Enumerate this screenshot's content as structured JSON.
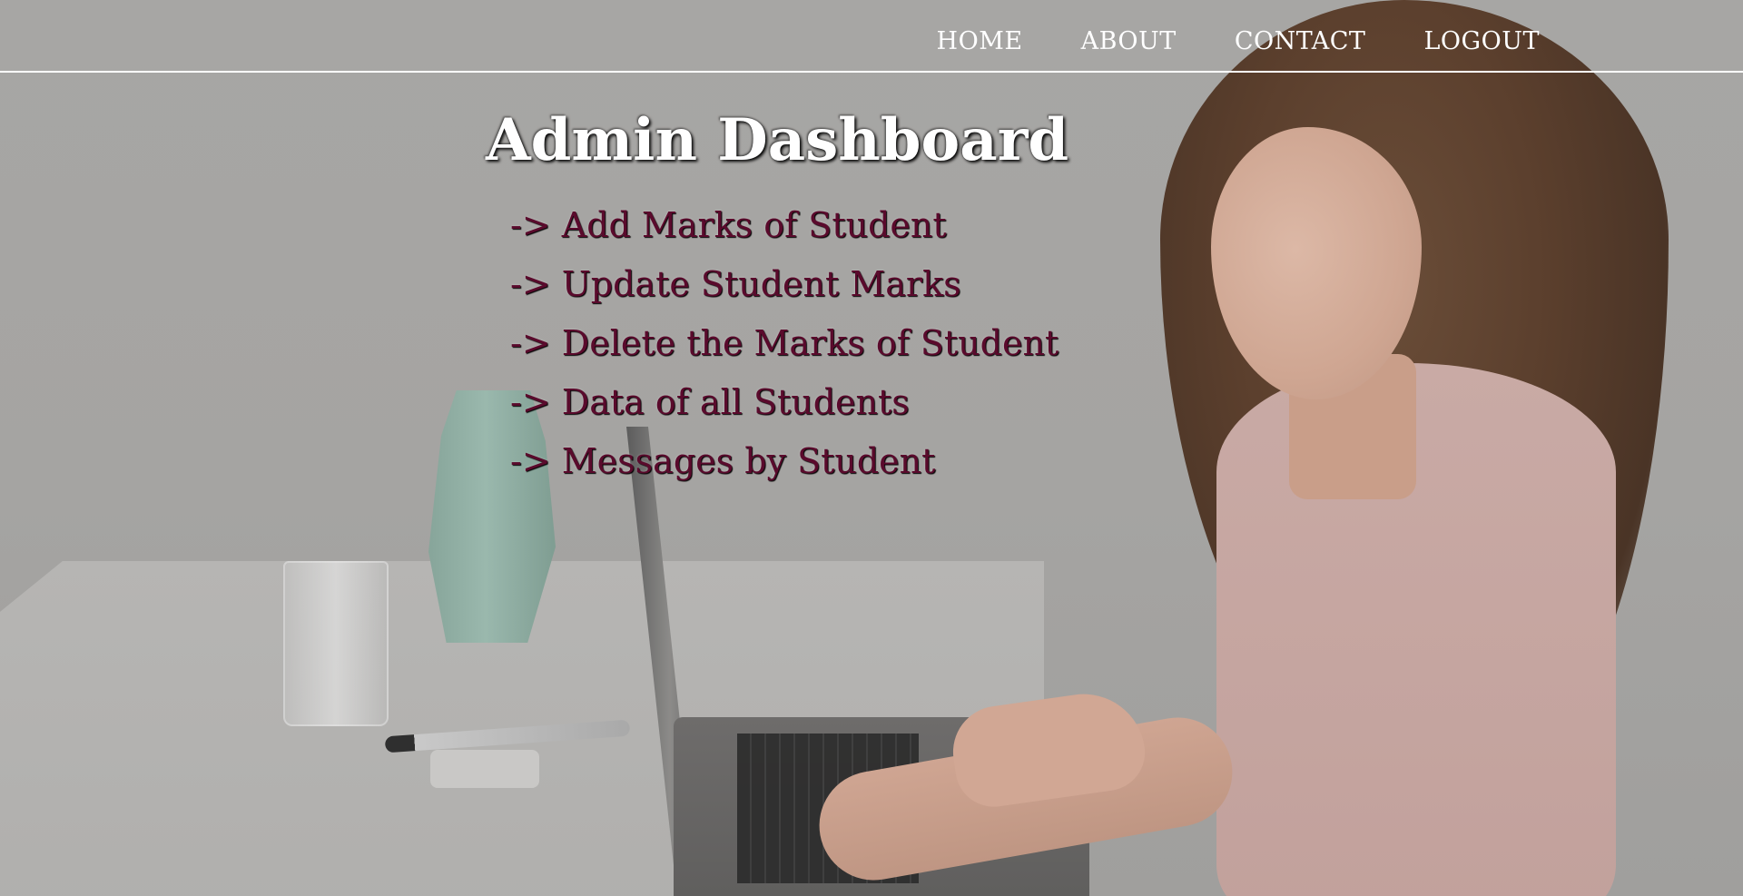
{
  "nav": {
    "items": [
      {
        "label": "HOME"
      },
      {
        "label": "ABOUT"
      },
      {
        "label": "CONTACT"
      },
      {
        "label": "LOGOUT"
      }
    ]
  },
  "page": {
    "title": "Admin Dashboard"
  },
  "menu": {
    "items": [
      {
        "label": "-> Add Marks of Student"
      },
      {
        "label": "-> Update Student Marks"
      },
      {
        "label": "-> Delete the Marks of Student"
      },
      {
        "label": "-> Data of all Students"
      },
      {
        "label": "-> Messages by Student"
      }
    ]
  },
  "colors": {
    "nav_text": "#ffffff",
    "title_text": "#ffffff",
    "menu_text": "#5a0a2c",
    "overlay": "#a8a6a4"
  }
}
